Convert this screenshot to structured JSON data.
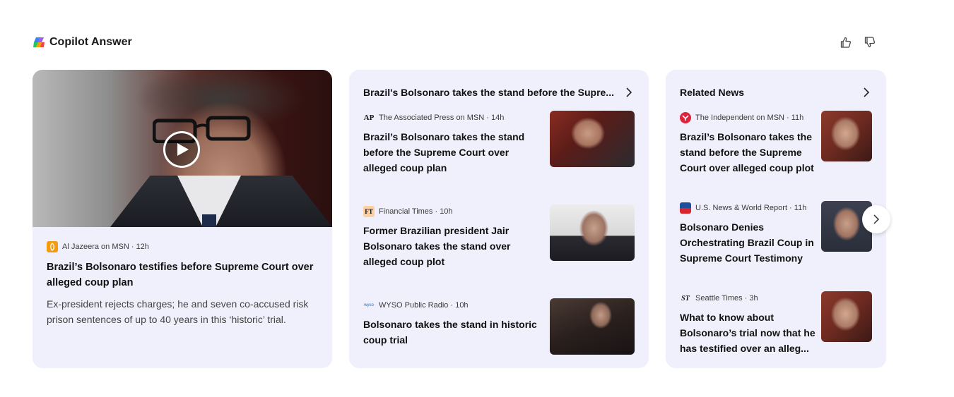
{
  "header": {
    "title": "Copilot Answer",
    "logo_icon": "copilot-logo-icon"
  },
  "feedback": {
    "like_icon": "thumbs-up-icon",
    "dislike_icon": "thumbs-down-icon"
  },
  "main_card": {
    "source": "Al Jazeera on MSN · 12h",
    "source_icon": "al-jazeera-logo-icon",
    "title": "Brazil’s Bolsonaro testifies before Supreme Court over alleged coup plan",
    "description": "Ex-president rejects charges; he and seven co-accused risk prison sentences of up to 40 years in this ‘historic’ trial.",
    "play_icon": "play-icon"
  },
  "mid_card": {
    "header": "Brazil's Bolsonaro takes the stand before the Supre...",
    "items": [
      {
        "source": "The Associated Press on MSN · 14h",
        "logo": "AP",
        "title": "Brazil’s Bolsonaro takes the stand before the Supreme Court over alleged coup plan"
      },
      {
        "source": "Financial Times · 10h",
        "logo": "FT",
        "title": "Former Brazilian president Jair Bolsonaro takes the stand over alleged coup plot"
      },
      {
        "source": "WYSO Public Radio · 10h",
        "logo": "wyso",
        "title": "Bolsonaro takes the stand in historic coup trial"
      }
    ]
  },
  "right_card": {
    "header": "Related News",
    "items": [
      {
        "source": "The Independent on MSN · 11h",
        "title": "Brazil’s Bolsonaro takes the stand before the Supreme Court over alleged coup plot"
      },
      {
        "source": "U.S. News & World Report · 11h",
        "title": "Bolsonaro Denies Orchestrating Brazil Coup in Supreme Court Testimony"
      },
      {
        "source": "Seattle Times · 3h",
        "logo": "ST",
        "title": "What to know about Bolsonaro’s trial now that he has testified over an alleg..."
      }
    ]
  },
  "colors": {
    "card_bg": "#eff0fb",
    "accent_ap": "#e0001b",
    "independent": "#e0223a",
    "usnews": "#1f4e9c",
    "aljazeera": "#f39c12"
  }
}
